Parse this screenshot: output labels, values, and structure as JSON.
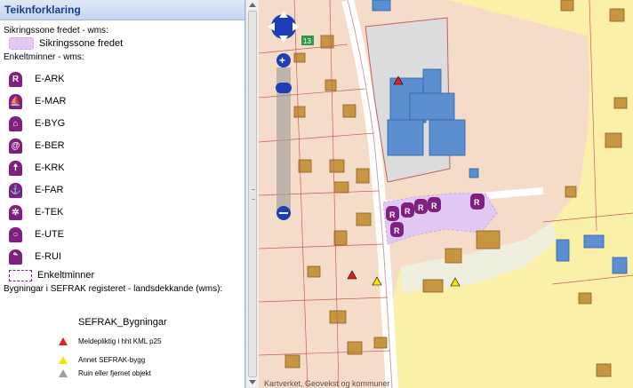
{
  "legend": {
    "title": "Teiknforklaring",
    "sikringssone_title": "Sikringssone fredet - wms:",
    "sikringssone_label": "Sikringssone fredet",
    "enkeltminner_title": "Enkeltminner - wms:",
    "items": [
      {
        "label": "E-ARK",
        "icon": "r-icon"
      },
      {
        "label": "E-MAR",
        "icon": "ship-icon"
      },
      {
        "label": "E-BYG",
        "icon": "house-icon"
      },
      {
        "label": "E-BER",
        "icon": "spiral-icon"
      },
      {
        "label": "E-KRK",
        "icon": "person-icon"
      },
      {
        "label": "E-FAR",
        "icon": "anchor-icon"
      },
      {
        "label": "E-TEK",
        "icon": "gear-icon"
      },
      {
        "label": "E-UTE",
        "icon": "ring-icon"
      },
      {
        "label": "E-RUI",
        "icon": "ruin-icon"
      }
    ],
    "enkeltminner_label": "Enkeltminner",
    "bygningar_title": "Bygningar i SEFRAK registeret - landsdekkande (wms):",
    "sefrak_title": "SEFRAK_Bygningar",
    "sefrak_items": [
      {
        "label": "Meldepliktig i hht KML p25",
        "color": "#e02020"
      },
      {
        "label": "Annet SEFRAK-bygg",
        "color": "#f5e400"
      },
      {
        "label": "Ruin eller fjernet objekt",
        "color": "#a0a0a0"
      }
    ]
  },
  "map": {
    "road_label": "13",
    "attribution": "Kartverket, Geovekst og kommuner"
  },
  "colors": {
    "accent": "#7f1f7f",
    "header_text": "#15428b",
    "residential": "#f5dcc8",
    "field": "#faf0a8",
    "building_blue": "#5b8fcf",
    "building_brown": "#c89540"
  }
}
